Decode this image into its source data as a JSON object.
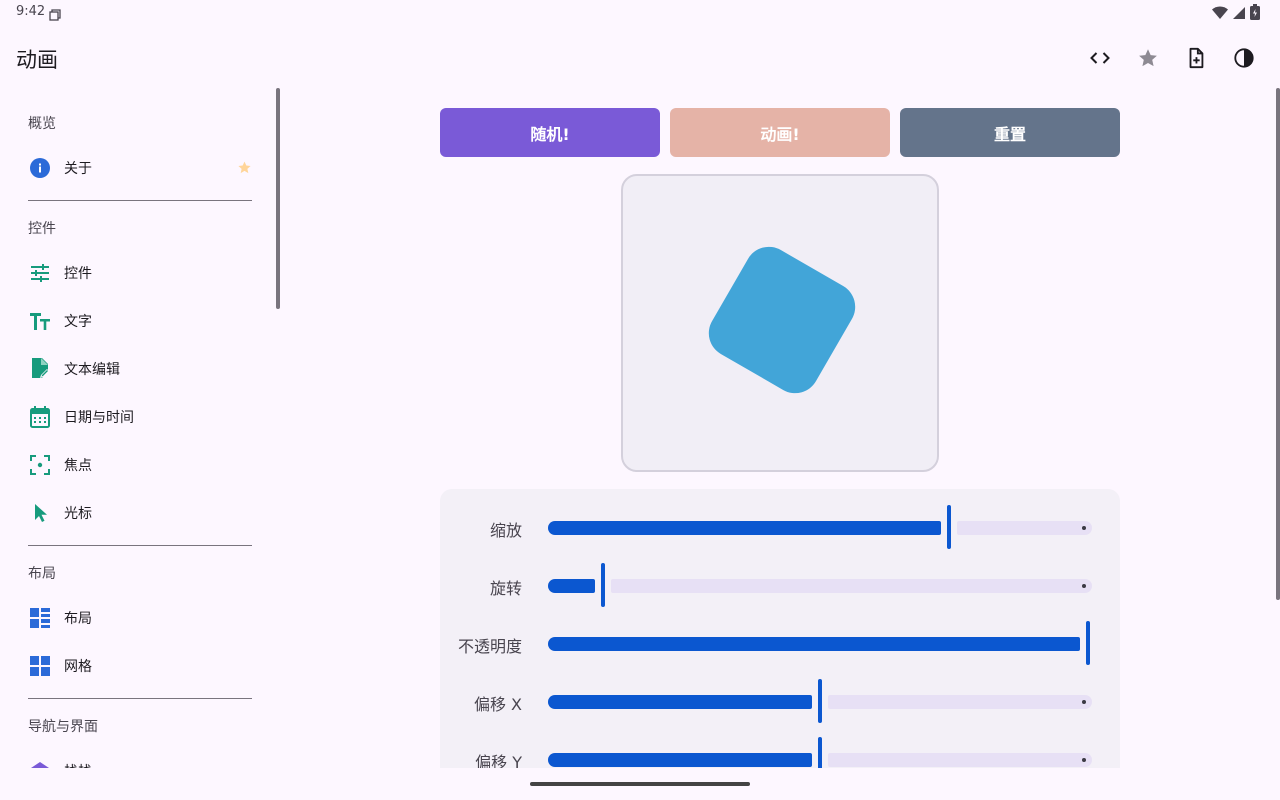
{
  "status": {
    "time": "9:42"
  },
  "app": {
    "title": "动画",
    "actions": [
      {
        "name": "code-icon"
      },
      {
        "name": "star-icon"
      },
      {
        "name": "add-file-icon"
      },
      {
        "name": "contrast-icon"
      }
    ]
  },
  "sidebar": {
    "sections": [
      "概览",
      "控件",
      "布局",
      "导航与界面"
    ],
    "items": [
      {
        "label": "关于",
        "icon": "info-icon"
      },
      {
        "label": "控件",
        "icon": "tune-icon"
      },
      {
        "label": "文字",
        "icon": "text-icon"
      },
      {
        "label": "文本编辑",
        "icon": "edit-note-icon"
      },
      {
        "label": "日期与时间",
        "icon": "calendar-icon"
      },
      {
        "label": "焦点",
        "icon": "focus-icon"
      },
      {
        "label": "光标",
        "icon": "cursor-icon"
      },
      {
        "label": "布局",
        "icon": "layout-icon"
      },
      {
        "label": "网格",
        "icon": "grid-icon"
      },
      {
        "label": "栈栈",
        "icon": "stack-icon"
      }
    ]
  },
  "buttons": {
    "random": "随机!",
    "animate": "动画!",
    "reset": "重置"
  },
  "preview": {
    "color": "#42a5d8",
    "rotation_deg": 30
  },
  "controls": [
    {
      "label": "缩放",
      "value": 0.74
    },
    {
      "label": "旋转",
      "value": 0.095
    },
    {
      "label": "不透明度",
      "value": 1.0
    },
    {
      "label": "偏移 X",
      "value": 0.5
    },
    {
      "label": "偏移 Y",
      "value": 0.5
    }
  ],
  "colors": {
    "accent": "#0b57d0",
    "random_btn": "#7a5ad7",
    "animate_btn": "#e5b3a7",
    "reset_btn": "#64748b"
  }
}
